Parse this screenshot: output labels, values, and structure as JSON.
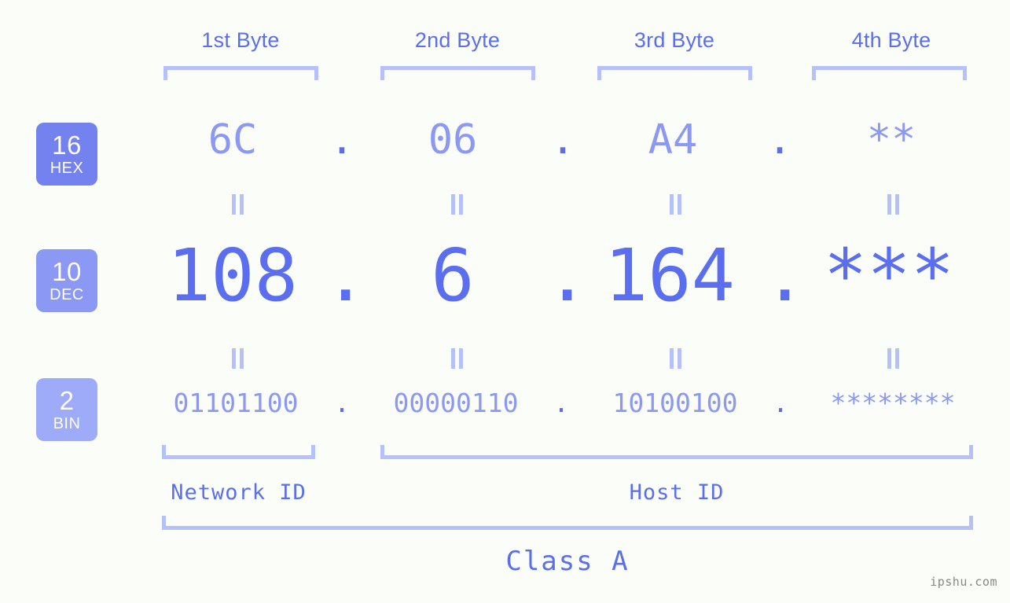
{
  "meta": {
    "background_color": "#fbfdf8",
    "accent_strong": "#5b6ef0",
    "accent_mid": "#8b98f4",
    "accent_light": "#b6c0fb",
    "watermark": "ipshu.com"
  },
  "byte_headers": [
    {
      "label": "1st Byte"
    },
    {
      "label": "2nd Byte"
    },
    {
      "label": "3rd Byte"
    },
    {
      "label": "4th Byte"
    }
  ],
  "bases": [
    {
      "number": "16",
      "name": "HEX",
      "color": "#7382ef"
    },
    {
      "number": "10",
      "name": "DEC",
      "color": "#8b98f4"
    },
    {
      "number": "2",
      "name": "BIN",
      "color": "#9eabf9"
    }
  ],
  "rows": {
    "hex": {
      "base_number": "16",
      "base_name": "HEX",
      "values": [
        "6C",
        "06",
        "A4",
        "**"
      ],
      "separators": [
        ".",
        ".",
        "."
      ]
    },
    "dec": {
      "base_number": "10",
      "base_name": "DEC",
      "values": [
        "108",
        "6",
        "164",
        "***"
      ],
      "separators": [
        ".",
        ".",
        "."
      ]
    },
    "bin": {
      "base_number": "2",
      "base_name": "BIN",
      "values": [
        "01101100",
        "00000110",
        "10100100",
        "********"
      ],
      "separators": [
        ".",
        ".",
        "."
      ]
    }
  },
  "equals_symbol": "‖",
  "segments": {
    "network_id": "Network ID",
    "host_id": "Host ID",
    "class": "Class A"
  }
}
